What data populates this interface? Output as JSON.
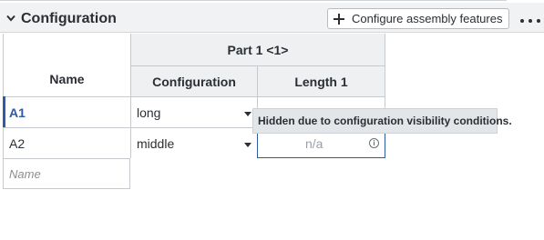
{
  "panel": {
    "title": "Configuration",
    "configure_button_label": "Configure assembly features"
  },
  "table": {
    "group_header": "Part 1 <1>",
    "columns": {
      "name": "Name",
      "configuration": "Configuration",
      "length": "Length 1"
    },
    "rows": [
      {
        "name": "A1",
        "configuration": "long",
        "length": ""
      },
      {
        "name": "A2",
        "configuration": "middle",
        "length": "n/a"
      }
    ],
    "new_row_placeholder": "Name"
  },
  "tooltip": {
    "text": "Hidden due to configuration visibility conditions."
  },
  "colors": {
    "accent": "#2e5aa7",
    "header_bg": "#f1f2f4",
    "grid": "#c6c9cd"
  }
}
